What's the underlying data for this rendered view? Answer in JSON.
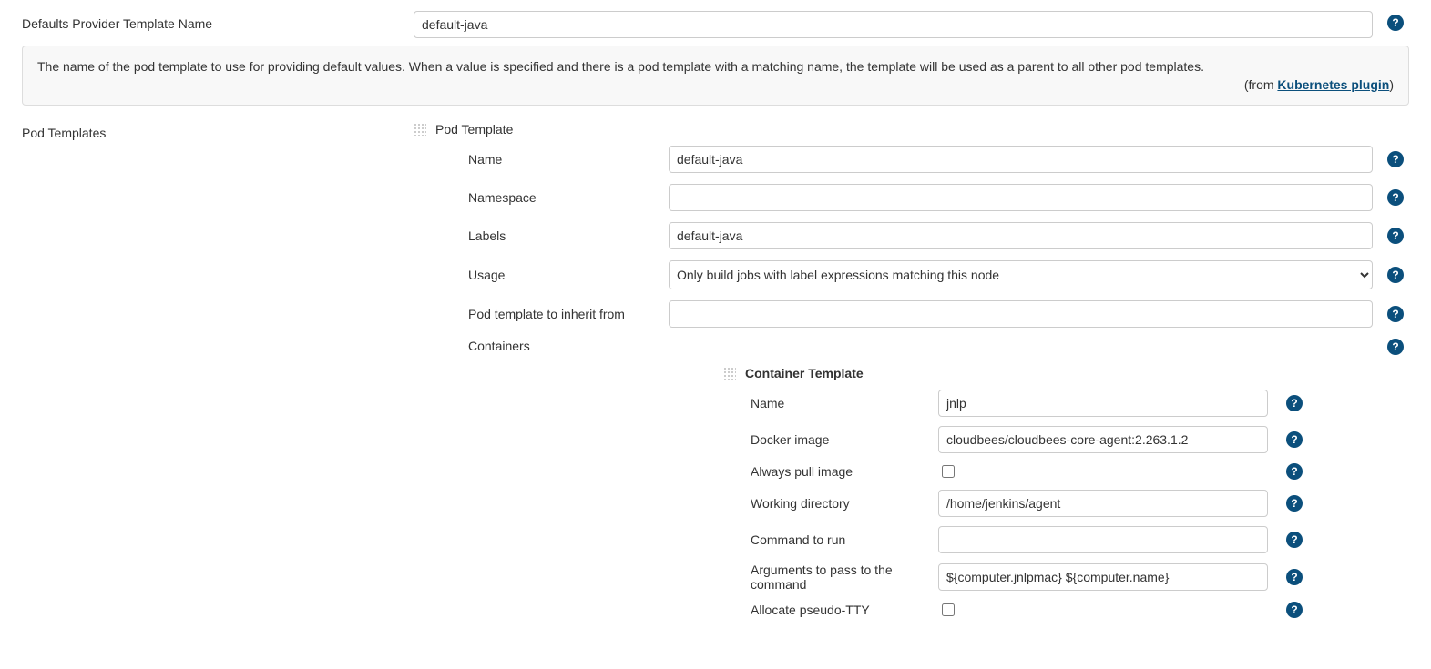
{
  "defaults_provider": {
    "label": "Defaults Provider Template Name",
    "value": "default-java"
  },
  "help_box": {
    "text": "The name of the pod template to use for providing default values. When a value is specified and there is a pod template with a matching name, the template will be used as a parent to all other pod templates.",
    "from_prefix": "(from ",
    "link_text": "Kubernetes plugin",
    "from_suffix": ")"
  },
  "pod_templates_label": "Pod Templates",
  "pod_template_header": "Pod Template",
  "pod": {
    "name_label": "Name",
    "name_value": "default-java",
    "namespace_label": "Namespace",
    "namespace_value": "",
    "labels_label": "Labels",
    "labels_value": "default-java",
    "usage_label": "Usage",
    "usage_value": "Only build jobs with label expressions matching this node",
    "inherit_label": "Pod template to inherit from",
    "inherit_value": "",
    "containers_label": "Containers"
  },
  "container_template_header": "Container Template",
  "container": {
    "name_label": "Name",
    "name_value": "jnlp",
    "docker_label": "Docker image",
    "docker_value": "cloudbees/cloudbees-core-agent:2.263.1.2",
    "always_pull_label": "Always pull image",
    "workdir_label": "Working directory",
    "workdir_value": "/home/jenkins/agent",
    "command_label": "Command to run",
    "command_value": "",
    "args_label": "Arguments to pass to the command",
    "args_value": "${computer.jnlpmac} ${computer.name}",
    "tty_label": "Allocate pseudo-TTY"
  }
}
